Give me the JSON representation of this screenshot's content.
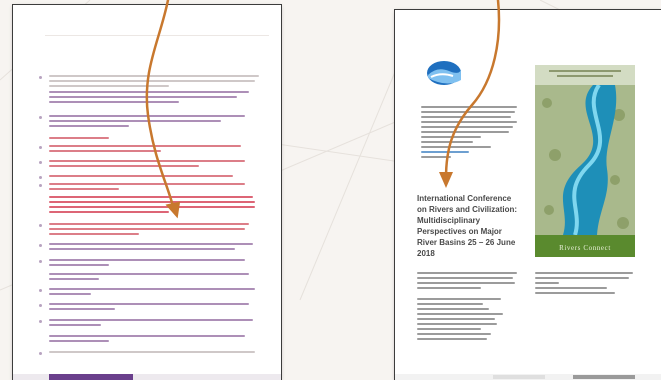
{
  "left_document": {
    "header_text": "",
    "accent_color": "#6a3f8c"
  },
  "right_document": {
    "header_text": "",
    "conference_title": "International Conference on Rivers and Civilization: Multidisciplinary Perspectives on Major River Basins 25 – 26 June 2018",
    "conference_title_tail": "",
    "cover_title": "Rivers Connect",
    "cover_color": "#5a8a2e"
  },
  "arrows": {
    "color": "#c8782e"
  }
}
